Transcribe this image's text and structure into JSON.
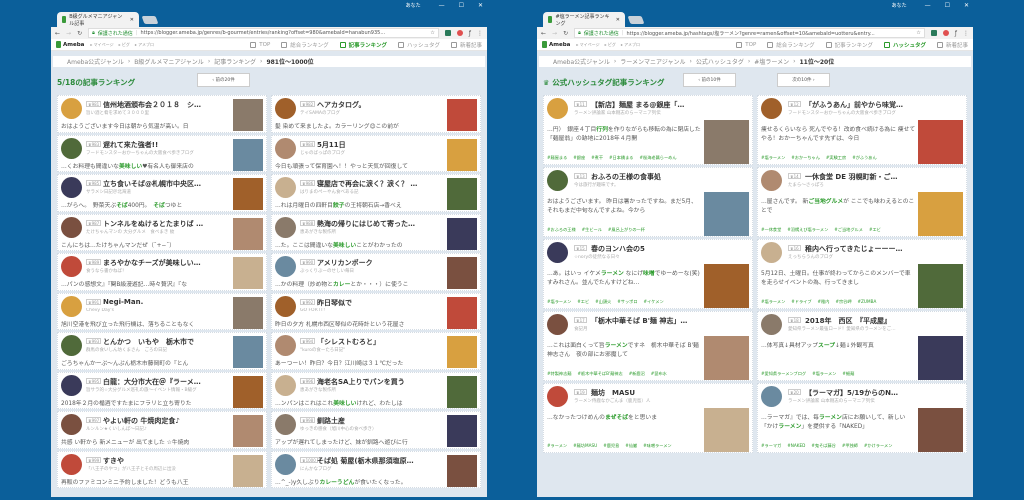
{
  "windows": [
    {
      "tab_title": "B級グルメマニアジャンル記事",
      "user": "あなた",
      "secure_label": "保護された通信",
      "url": "https://blogger.ameba.jp/genres/b-gourmet/entries/ranking?offset=980&amebaId=hanabun935...",
      "nav": {
        "logo": "Ameba",
        "sub": [
          "マイページ",
          "ピグ",
          "アメブロ"
        ],
        "items": [
          "TOP",
          "総合ランキング",
          "記事ランキング",
          "ハッシュタグ",
          "新着記事"
        ],
        "active": 2
      },
      "breadcrumb": [
        "Ameba公式ジャンル",
        "B級グルメマニアジャンル",
        "記事ランキング",
        "981位〜1000位"
      ],
      "heading": "5/18の記事ランキング",
      "prev_button": "前の20件",
      "columns": [
        [
          {
            "rank": "981",
            "title": "信州地酒頒布会２０１８　シ…",
            "blog": "旨い酒と肴を求めて３０００里",
            "excerpt": [
              "おはようございます今日は朝から気温が高い。日"
            ]
          },
          {
            "rank": "983",
            "title": "遅れて来た強者!!",
            "blog": "フードモンスターおかーちゃんの大阪食べ歩きブログ",
            "excerpt": [
              "…くお料理も間違いな",
              "美味しい",
              "♥有名人も御来店の"
            ]
          },
          {
            "rank": "985",
            "title": "立ち食いそば@札幌市中央区…",
            "blog": "サラメシ日記＠北海道",
            "excerpt": [
              "…がらへ。　野菜天ぷ",
              "そば",
              "400円。　",
              "そば",
              "つゆと"
            ]
          },
          {
            "rank": "987",
            "title": "トンネルをぬけるとたまりば …",
            "blog": "たけちゃんマンの 大分グルメ　食べまき 紋",
            "excerpt": [
              "こんにちは…たけちゃんマンだぜ（¯+−¯）"
            ]
          },
          {
            "rank": "989",
            "title": "まろやかなチーズが美味しい…",
            "blog": "食うなら書かねば！",
            "excerpt": [
              "…パンの感想文』『関B級漫遊記…時々贅沢』『な"
            ]
          },
          {
            "rank": "991",
            "title": "Negi-Man.",
            "blog": "Chevy Day's",
            "excerpt": [
              "旭川空港を飛び立った飛行機は、落ちることもなく"
            ]
          },
          {
            "rank": "993",
            "title": "とんかつ　いもや　栃木市で",
            "blog": "群馬の食いしん坊くまさん　ごろの日記",
            "excerpt": [
              "ごろちゃんかーぷ〜んぷん栃木市藤岡町の『とん"
            ]
          },
          {
            "rank": "995",
            "title": "白龍：大分市大在＠『ラーメ…",
            "blog": "旨サラ的☆大分グルメ巡礼の旅〜イベント情報・B級グ",
            "excerpt": [
              "2018年２月の楯酒ですたまにフラリと立ち寄りた"
            ]
          },
          {
            "rank": "997",
            "title": "やよい軒の 牛焼肉定食♪",
            "blog": "ルンルン★くいしんぼ〜日記♪",
            "excerpt": [
              "共感 い軒から 新メニューが 出てました ☆牛焼肉"
            ]
          },
          {
            "rank": "999",
            "title": "すきや",
            "blog": "「八王子のやつ」が八王子とその周辺に出没",
            "excerpt": [
              "再販のファミコンミニ予約しました！どうも八王"
            ]
          }
        ],
        [
          {
            "rank": "982",
            "title": "ヘアカタログ。",
            "blog": "テイSAMAのブログ",
            "excerpt": [
              "髪 染めて来ましたよ。カラーリング😊この前が"
            ]
          },
          {
            "rank": "984",
            "title": "5月11日",
            "blog": "じゃのばっぱのブログ",
            "excerpt": [
              "今日も頑張って保育園へ！！やっと天気が回復して"
            ]
          },
          {
            "rank": "986",
            "title": "寝屋店で再会に涙く？涙く？ …",
            "blog": "はりまのぺーやん食べある記",
            "excerpt": [
              "…れは月曜日の四軒目",
              "餃子",
              "の王将朝石店→香べえ"
            ]
          },
          {
            "rank": "988",
            "title": "熱海の帰りにはじめて寄った…",
            "blog": "恵あがきな製作所",
            "excerpt": [
              "…た。ここは間違いな",
              "美味しい",
              "ことがわかったの"
            ]
          },
          {
            "rank": "990",
            "title": "アメリカンポーク",
            "blog": "ぶっくりぶーのせしい毎日",
            "excerpt": [
              "…かの料理（炒め物と",
              "カレー",
              "とか・・・）に使うこ"
            ]
          },
          {
            "rank": "992",
            "title": "昨日琴似で",
            "blog": "GO FOR IT!",
            "excerpt": [
              "昨日の夕方 札幌市西区琴似の花時計という花屋さ"
            ]
          },
          {
            "rank": "994",
            "title": "「シレストむろと」",
            "blog": "\"kuroの食ーたろ日記\"",
            "excerpt": [
              "あーつーい！昨日？今日？江川崎は３１℃だった"
            ]
          },
          {
            "rank": "996",
            "title": "海老名SA上りでパンを買う",
            "blog": "恵あがきな製作所",
            "excerpt": [
              "…ンパンはこれはこれ",
              "美味しい",
              "けれど、わたしは"
            ]
          },
          {
            "rank": "998",
            "title": "釧路土産",
            "blog": "ゆっきの感食（旭川中心の食べ歩き）",
            "excerpt": [
              "アップが遅れてしまったけど、妹が釧路へ遊びに行"
            ]
          },
          {
            "rank": "1000",
            "title": "そば処 菊屋(栃木県那須塩原…",
            "blog": "にんかなブログ",
            "excerpt": [
              "…^_-)y久しぶり",
              "カレーうどん",
              "が食いたくなった。"
            ]
          }
        ]
      ]
    },
    {
      "tab_title": "#塩ラーメン記事ランキング",
      "user": "あなた",
      "secure_label": "保護された通信",
      "url": "https://blogger.ameba.jp/hashtags/塩ラーメン?genre=ramen&offset=10&amebaId=uotteru&entry...",
      "nav": {
        "logo": "Ameba",
        "sub": [
          "マイページ",
          "ピグ",
          "アメブロ"
        ],
        "items": [
          "TOP",
          "総合ランキング",
          "記事ランキング",
          "ハッシュタグ",
          "新着記事"
        ],
        "active": 3
      },
      "breadcrumb": [
        "Ameba公式ジャンル",
        "ラーメンマニアジャンル",
        "公式ハッシュタグ",
        "#塩ラーメン",
        "11位〜20位"
      ],
      "heading": "公式ハッシュタグ記事ランキング",
      "prev_button": "前の10件",
      "next_button": "次の10件",
      "columns": [
        [
          {
            "rank": "11",
            "title": "【新店】麺屋 まる@銀座「…",
            "blog": "ラーメン評論家 山本剛志のらーマニア列伝",
            "excerpt": [
              "…円）　銀座４丁目",
              "行列",
              "を作りながらも移転の為に閉店した「麺屋翁」の跡地に2018年４月開"
            ],
            "tags": [
              "#麺屋まる",
              "#銀座",
              "#煮干",
              "#日本橋まる",
              "#桜海老醤らーめん"
            ]
          },
          {
            "rank": "13",
            "title": "おふろの王様の食事処",
            "blog": "今は旅行が趣味です。",
            "excerpt": [
              "おはようございます。 昨日は暑かったですね。まだ5月、それもまだ中旬なんですよね。今から"
            ],
            "tags": [
              "#おふろの王様",
              "#生ビール",
              "#風呂上がりの一杯"
            ]
          },
          {
            "rank": "15",
            "title": "春のヨンハ会の5",
            "blog": "☆noryの徒然なる日々",
            "excerpt": [
              "…あ。はいっ イケメ",
              "ラーメン",
              " なにげ",
              "味噌",
              "でゆーめーな(笑)すみれさん。並んでたんすけどね…"
            ],
            "tags": [
              "#塩ラーメン",
              "#エビ",
              "#山頭火",
              "#サッポロ",
              "#イケメン"
            ]
          },
          {
            "rank": "17",
            "title": "「栃木中華そば B'麺 神志」…",
            "blog": "食記月",
            "excerpt": [
              "…これは面白くって旨",
              "ラーメン",
              "ですネ　栃木中華そば B'麺 神志さん　夜の部にお邪魔して"
            ],
            "tags": [
              "#特製神志麺",
              "#栃木中華そばB'麺神志",
              "#新鹿沼",
              "#昆布水"
            ]
          },
          {
            "rank": "19",
            "title": "麺坊　MASU",
            "blog": "ラーメン侍鹿なかごんま（鹿児島）人",
            "excerpt": [
              "…なかったつけめんの",
              "まぜそば",
              "をと思いま"
            ],
            "tags": [
              "#ラーメン",
              "#麺坊MASU",
              "#鹿児島",
              "#仙巌",
              "#味噌ラーメン"
            ]
          }
        ],
        [
          {
            "rank": "12",
            "title": "「がふうあん」前やから味覚…",
            "blog": "フードモンスターおかーちゃんの大阪食べ歩きブログ",
            "excerpt": [
              "痩せるくらいなら 死んでやる！改め食べ続ける為に 痩せてやる！おかーちゃんです先ずは、今日"
            ],
            "tags": [
              "#塩ラーメン",
              "#おかーちゃん",
              "#実験工房",
              "#がふうあん"
            ]
          },
          {
            "rank": "14",
            "title": "一休食堂 DE 羽幌町新・ご…",
            "blog": "たまら〜さっぽろ",
            "excerpt": [
              "…屋さんです。 新",
              "ご当地グルメ",
              "が ここでも味わえるとのことで"
            ],
            "tags": [
              "#一休食堂",
              "#羽幌えび塩ラーメン",
              "#ご当地グルメ",
              "#エビ"
            ]
          },
          {
            "rank": "16",
            "title": "稚内へ行ってきたじょーーー…",
            "blog": "えっちらうんのブログ",
            "excerpt": [
              "5月12日、土曜日。仕事が終わってからこのメンバーで車を走らせイベントの為、行ってきまし"
            ],
            "tags": [
              "#塩ラーメン",
              "#ドライブ",
              "#稚内",
              "#宗谷岬",
              "#ZUMBA"
            ]
          },
          {
            "rank": "18",
            "title": "2018年　西区　『平成屋』",
            "blog": "愛知県ラーメン最強ロード！愛知県のラーメンをご…",
            "excerpt": [
              "…体写真↓具材アップ",
              "スープ",
              "↓麺↓外観写真"
            ],
            "tags": [
              "#愛知県ラーメンブログ",
              "#塩ラーメン",
              "#細麺"
            ]
          },
          {
            "rank": "20",
            "title": "【ラーマガ】5/19からのN…",
            "blog": "ラーメン評論家 山本剛志のらーマニア列伝",
            "excerpt": [
              "…ラーマガ』では、毎",
              "ラーメン",
              "店にお願いして、新しい「かけ",
              "ラーメン",
              "」を提供する「NAKED」"
            ],
            "tags": [
              "#ラーマガ",
              "#NAKED",
              "#鬼そば藤谷",
              "#甲独師",
              "#かけラーメン"
            ]
          }
        ]
      ]
    }
  ],
  "colors": {
    "desktop": "#0b5f9a",
    "accent": "#2a9a2a",
    "page_bg": "#dfe7ef"
  }
}
